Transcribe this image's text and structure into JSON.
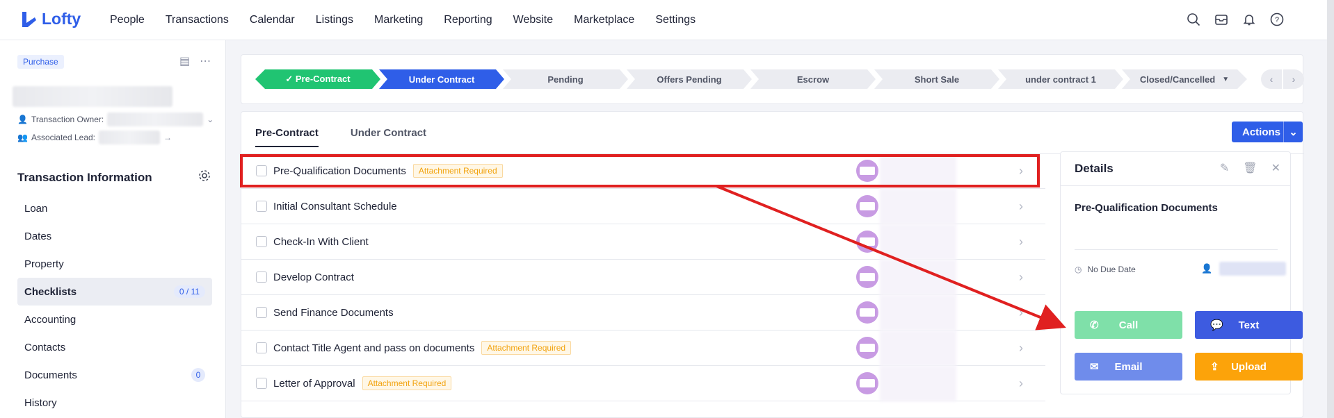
{
  "app": {
    "name": "Lofty",
    "brand_color": "#2f5ee8"
  },
  "nav": {
    "items": [
      "People",
      "Transactions",
      "Calendar",
      "Listings",
      "Marketing",
      "Reporting",
      "Website",
      "Marketplace",
      "Settings"
    ]
  },
  "sidebar": {
    "badge": "Purchase",
    "owner_label": "Transaction Owner:",
    "lead_label": "Associated Lead:",
    "section_title": "Transaction Information",
    "menu": [
      {
        "label": "Loan"
      },
      {
        "label": "Dates"
      },
      {
        "label": "Property"
      },
      {
        "label": "Checklists",
        "count": "0 / 11",
        "active": true
      },
      {
        "label": "Accounting"
      },
      {
        "label": "Contacts"
      },
      {
        "label": "Documents",
        "count": "0"
      },
      {
        "label": "History"
      }
    ]
  },
  "stages": [
    {
      "label": "✓ Pre-Contract",
      "state": "done"
    },
    {
      "label": "Under Contract",
      "state": "current"
    },
    {
      "label": "Pending",
      "state": "todo"
    },
    {
      "label": "Offers Pending",
      "state": "todo"
    },
    {
      "label": "Escrow",
      "state": "todo"
    },
    {
      "label": "Short Sale",
      "state": "todo"
    },
    {
      "label": "under contract 1",
      "state": "todo"
    },
    {
      "label": "Closed/Cancelled",
      "state": "todo"
    }
  ],
  "tabs": [
    "Pre-Contract",
    "Under Contract"
  ],
  "actions_label": "Actions",
  "tasks": [
    {
      "title": "Pre-Qualification Documents",
      "tag": "Attachment Required"
    },
    {
      "title": "Initial Consultant Schedule",
      "tag": ""
    },
    {
      "title": "Check-In With Client",
      "tag": ""
    },
    {
      "title": "Develop Contract",
      "tag": ""
    },
    {
      "title": "Send Finance Documents",
      "tag": ""
    },
    {
      "title": "Contact Title Agent and pass on documents",
      "tag": "Attachment Required"
    },
    {
      "title": "Letter of Approval",
      "tag": "Attachment Required"
    }
  ],
  "details": {
    "header": "Details",
    "title": "Pre-Qualification Documents",
    "due": "No Due Date",
    "buttons": {
      "call": "Call",
      "text": "Text",
      "email": "Email",
      "upload": "Upload"
    }
  }
}
